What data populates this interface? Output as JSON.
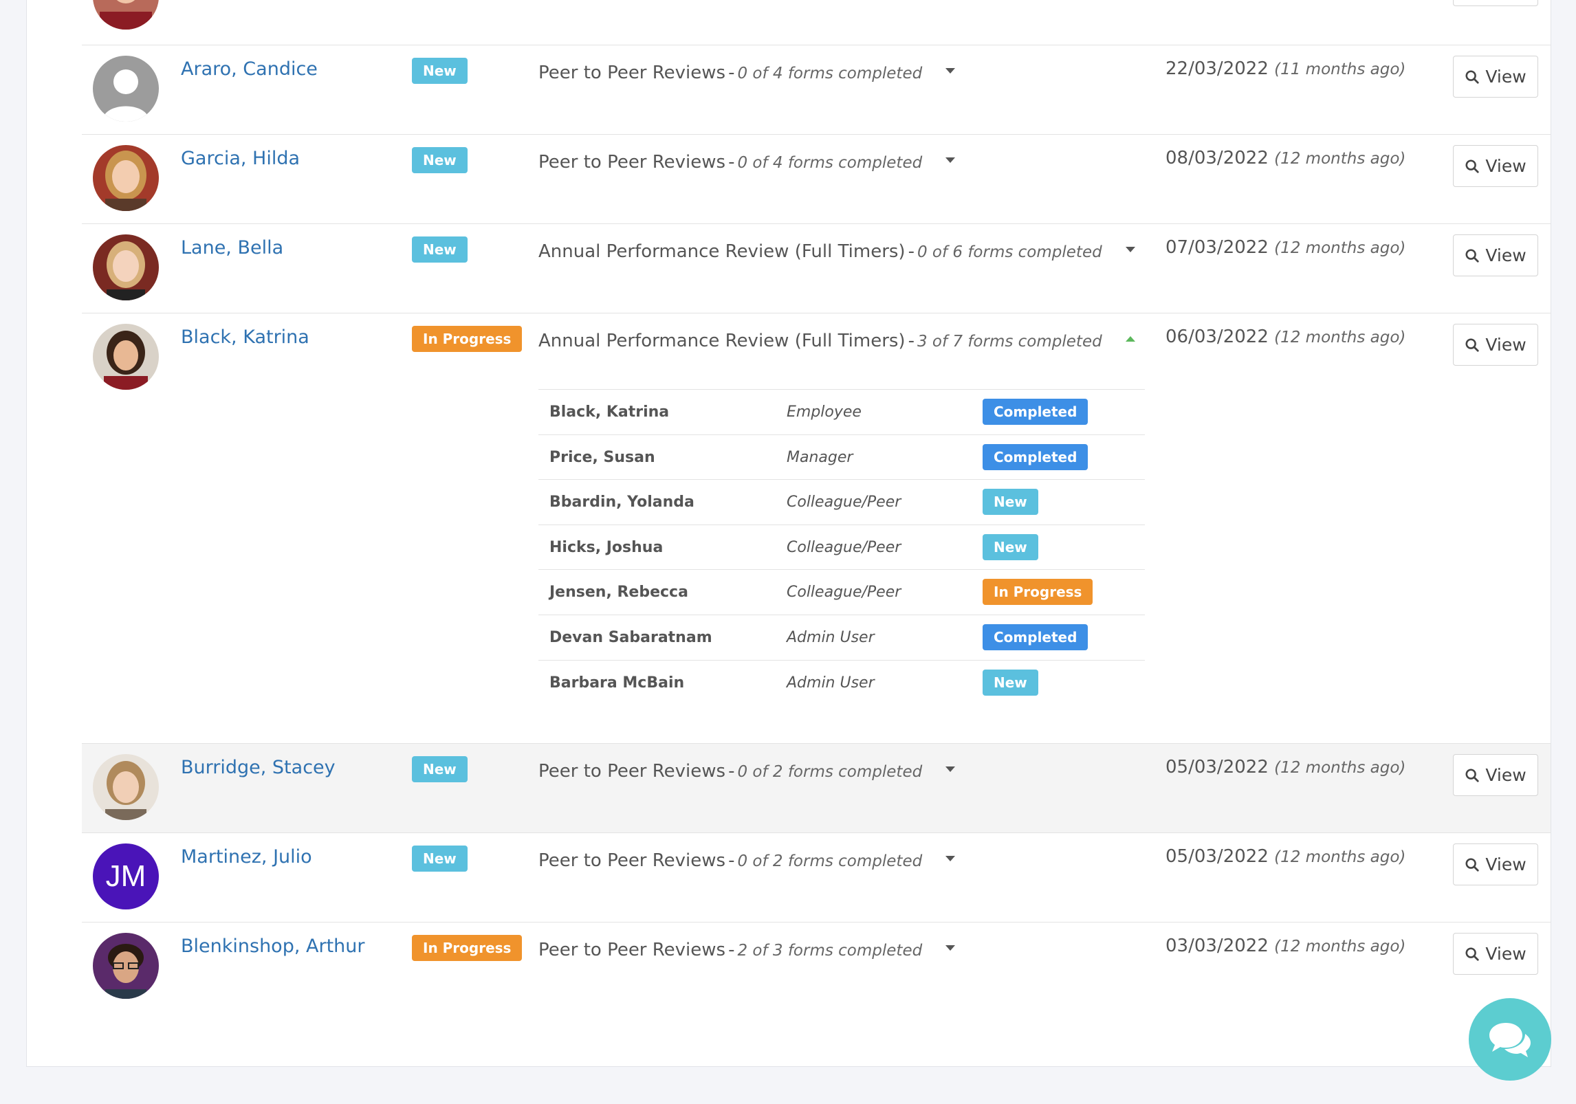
{
  "rows": [
    {
      "name": "Araro, Candice",
      "status": "New",
      "review": "Peer to Peer Reviews",
      "progress": "0 of 4 forms completed",
      "date": "22/03/2022",
      "ago": "(11 months ago)",
      "view": "View"
    },
    {
      "name": "Garcia, Hilda",
      "status": "New",
      "review": "Peer to Peer Reviews",
      "progress": "0 of 4 forms completed",
      "date": "08/03/2022",
      "ago": "(12 months ago)",
      "view": "View"
    },
    {
      "name": "Lane, Bella",
      "status": "New",
      "review": "Annual Performance Review (Full Timers)",
      "progress": "0 of 6 forms completed",
      "date": "07/03/2022",
      "ago": "(12 months ago)",
      "view": "View"
    },
    {
      "name": "Black, Katrina",
      "status": "In Progress",
      "review": "Annual Performance Review (Full Timers)",
      "progress": "3 of 7 forms completed",
      "date": "06/03/2022",
      "ago": "(12 months ago)",
      "view": "View"
    },
    {
      "name": "Burridge, Stacey",
      "status": "New",
      "review": "Peer to Peer Reviews",
      "progress": "0 of 2 forms completed",
      "date": "05/03/2022",
      "ago": "(12 months ago)",
      "view": "View"
    },
    {
      "name": "Martinez, Julio",
      "initials": "JM",
      "status": "New",
      "review": "Peer to Peer Reviews",
      "progress": "0 of 2 forms completed",
      "date": "05/03/2022",
      "ago": "(12 months ago)",
      "view": "View"
    },
    {
      "name": "Blenkinshop, Arthur",
      "status": "In Progress",
      "review": "Peer to Peer Reviews",
      "progress": "2 of 3 forms completed",
      "date": "03/03/2022",
      "ago": "(12 months ago)",
      "view": "View"
    }
  ],
  "separator": "-",
  "forms": [
    {
      "name": "Black, Katrina",
      "role": "Employee",
      "status": "Completed"
    },
    {
      "name": "Price, Susan",
      "role": "Manager",
      "status": "Completed"
    },
    {
      "name": "Bbardin, Yolanda",
      "role": "Colleague/Peer",
      "status": "New"
    },
    {
      "name": "Hicks, Joshua",
      "role": "Colleague/Peer",
      "status": "New"
    },
    {
      "name": "Jensen, Rebecca",
      "role": "Colleague/Peer",
      "status": "In Progress"
    },
    {
      "name": "Devan Sabaratnam",
      "role": "Admin User",
      "status": "Completed"
    },
    {
      "name": "Barbara McBain",
      "role": "Admin User",
      "status": "New"
    }
  ],
  "colors": {
    "new": "#5bc0de",
    "in_progress": "#f0932c",
    "completed": "#3d8fe6",
    "link": "#2f72b1",
    "chat": "#5ccdd0"
  },
  "icons": {
    "view": "search-icon",
    "expand": "caret-down-icon",
    "collapse": "caret-up-icon",
    "chat": "chat-bubbles-icon"
  }
}
